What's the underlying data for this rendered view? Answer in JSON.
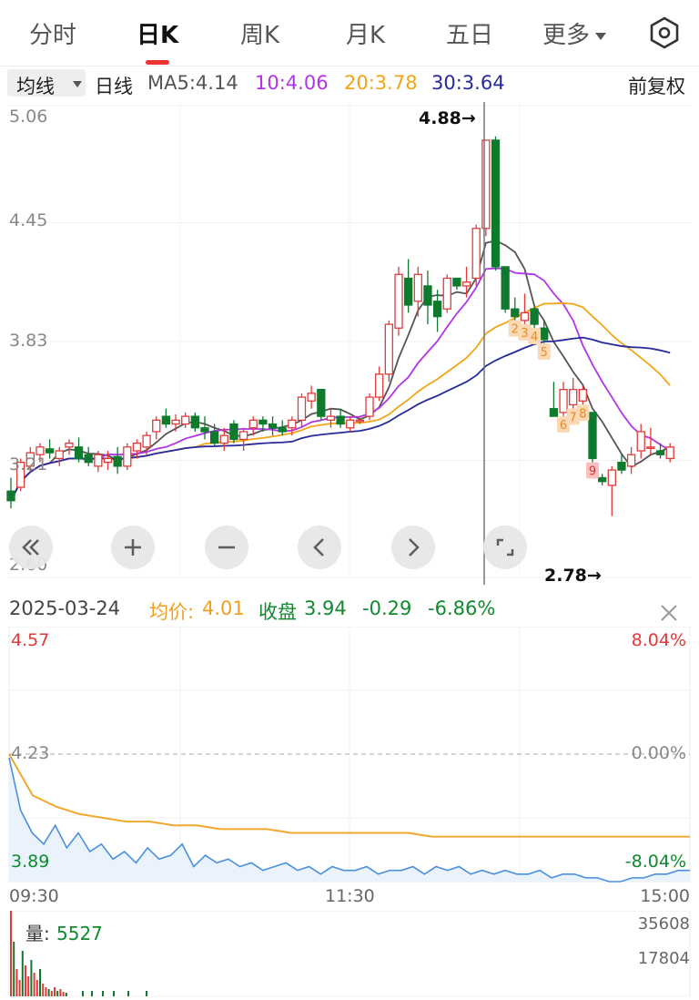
{
  "tabs": [
    {
      "label": "分时"
    },
    {
      "label": "日K"
    },
    {
      "label": "周K"
    },
    {
      "label": "月K"
    },
    {
      "label": "五日"
    },
    {
      "label": "更多"
    }
  ],
  "active_tab": "日K",
  "ma_bar": {
    "dropdown": "均线",
    "period": "日线",
    "ma5": "MA5:4.14",
    "ma10": "10:4.06",
    "ma20": "20:3.78",
    "ma30": "30:3.64",
    "adjust": "前复权"
  },
  "colors": {
    "up": "#e23a3a",
    "down": "#0f7a2e",
    "ma5": "#555555",
    "ma10": "#b233e8",
    "ma20": "#f2a516",
    "ma30": "#262a9a",
    "avg_price": "#f0a830",
    "price_line": "#4a8fdc"
  },
  "kline": {
    "y_labels": [
      "5.06",
      "4.45",
      "3.83",
      "3.21",
      "2.60"
    ],
    "high_marker": "4.88→",
    "low_marker": "2.78→",
    "seq_labels": [
      "2",
      "3",
      "4",
      "5",
      "6",
      "7",
      "8",
      "9"
    ],
    "controls": [
      "rewind-icon",
      "zoom-in-icon",
      "zoom-out-icon",
      "prev-icon",
      "next-icon",
      "fullscreen-icon"
    ],
    "candles": [
      [
        3.05,
        3.12,
        2.96,
        3.0
      ],
      [
        3.07,
        3.22,
        3.05,
        3.2
      ],
      [
        3.18,
        3.28,
        3.15,
        3.25
      ],
      [
        3.24,
        3.3,
        3.2,
        3.28
      ],
      [
        3.27,
        3.32,
        3.22,
        3.25
      ],
      [
        3.22,
        3.28,
        3.18,
        3.26
      ],
      [
        3.28,
        3.32,
        3.24,
        3.3
      ],
      [
        3.28,
        3.33,
        3.2,
        3.22
      ],
      [
        3.24,
        3.28,
        3.18,
        3.2
      ],
      [
        3.18,
        3.26,
        3.15,
        3.24
      ],
      [
        3.2,
        3.26,
        3.16,
        3.22
      ],
      [
        3.23,
        3.28,
        3.14,
        3.18
      ],
      [
        3.18,
        3.3,
        3.16,
        3.28
      ],
      [
        3.26,
        3.32,
        3.22,
        3.3
      ],
      [
        3.28,
        3.36,
        3.24,
        3.34
      ],
      [
        3.36,
        3.44,
        3.32,
        3.42
      ],
      [
        3.44,
        3.48,
        3.38,
        3.4
      ],
      [
        3.4,
        3.45,
        3.36,
        3.42
      ],
      [
        3.4,
        3.46,
        3.38,
        3.44
      ],
      [
        3.44,
        3.46,
        3.36,
        3.38
      ],
      [
        3.38,
        3.44,
        3.32,
        3.36
      ],
      [
        3.36,
        3.4,
        3.28,
        3.3
      ],
      [
        3.3,
        3.38,
        3.26,
        3.34
      ],
      [
        3.4,
        3.42,
        3.3,
        3.32
      ],
      [
        3.32,
        3.38,
        3.26,
        3.36
      ],
      [
        3.38,
        3.44,
        3.34,
        3.42
      ],
      [
        3.42,
        3.44,
        3.36,
        3.4
      ],
      [
        3.4,
        3.44,
        3.34,
        3.38
      ],
      [
        3.38,
        3.42,
        3.34,
        3.36
      ],
      [
        3.38,
        3.44,
        3.34,
        3.42
      ],
      [
        3.42,
        3.56,
        3.38,
        3.54
      ],
      [
        3.52,
        3.6,
        3.48,
        3.56
      ],
      [
        3.58,
        3.56,
        3.42,
        3.44
      ],
      [
        3.42,
        3.48,
        3.38,
        3.44
      ],
      [
        3.44,
        3.48,
        3.38,
        3.4
      ],
      [
        3.38,
        3.44,
        3.36,
        3.42
      ],
      [
        3.42,
        3.44,
        3.4,
        3.42
      ],
      [
        3.44,
        3.56,
        3.42,
        3.54
      ],
      [
        3.54,
        3.7,
        3.52,
        3.66
      ],
      [
        3.66,
        3.94,
        3.62,
        3.92
      ],
      [
        3.9,
        4.22,
        3.86,
        4.18
      ],
      [
        4.16,
        4.26,
        3.98,
        4.02
      ],
      [
        4.04,
        4.22,
        3.96,
        4.18
      ],
      [
        4.12,
        4.2,
        3.92,
        4.02
      ],
      [
        4.04,
        4.1,
        3.88,
        3.96
      ],
      [
        4.0,
        4.18,
        3.98,
        4.16
      ],
      [
        4.16,
        4.14,
        4.1,
        4.12
      ],
      [
        4.12,
        4.22,
        4.06,
        4.14
      ],
      [
        4.16,
        4.44,
        4.12,
        4.42
      ],
      [
        4.42,
        4.88,
        4.38,
        4.88
      ],
      [
        4.88,
        4.9,
        4.2,
        4.22
      ],
      [
        4.22,
        4.22,
        3.98,
        4.0
      ],
      [
        4.0,
        4.06,
        3.94,
        3.96
      ],
      [
        3.94,
        4.08,
        3.86,
        3.98
      ],
      [
        4.0,
        4.02,
        3.9,
        3.92
      ],
      [
        3.9,
        3.94,
        3.82,
        3.84
      ],
      [
        3.48,
        3.62,
        3.44,
        3.44
      ],
      [
        3.46,
        3.62,
        3.42,
        3.58
      ],
      [
        3.5,
        3.64,
        3.46,
        3.58
      ],
      [
        3.52,
        3.6,
        3.46,
        3.58
      ],
      [
        3.46,
        3.42,
        3.2,
        3.22
      ],
      [
        3.12,
        3.14,
        3.08,
        3.1
      ],
      [
        3.08,
        3.18,
        2.92,
        3.16
      ],
      [
        3.2,
        3.24,
        3.14,
        3.16
      ],
      [
        3.18,
        3.28,
        3.14,
        3.24
      ],
      [
        3.26,
        3.4,
        3.22,
        3.36
      ],
      [
        3.28,
        3.38,
        3.24,
        3.28
      ],
      [
        3.26,
        3.3,
        3.22,
        3.24
      ],
      [
        3.22,
        3.3,
        3.2,
        3.28
      ]
    ]
  },
  "intraday": {
    "date": "2025-03-24",
    "avg_label": "均价:",
    "avg_value": "4.01",
    "close_label": "收盘",
    "close_value": "3.94",
    "change": "-0.29",
    "change_pct": "-6.86%",
    "price_high": "4.57",
    "price_mid": "4.23",
    "price_low": "3.89",
    "pct_high": "8.04%",
    "pct_mid": "0.00%",
    "pct_low": "-8.04%",
    "time_start": "09:30",
    "time_mid": "11:30",
    "time_end": "15:00",
    "price_series": [
      4.22,
      4.08,
      4.02,
      3.99,
      4.04,
      3.98,
      4.02,
      3.97,
      3.99,
      3.95,
      3.97,
      3.94,
      3.98,
      3.95,
      3.96,
      3.99,
      3.93,
      3.96,
      3.94,
      3.95,
      3.93,
      3.94,
      3.92,
      3.93,
      3.94,
      3.92,
      3.93,
      3.91,
      3.93,
      3.92,
      3.92,
      3.93,
      3.91,
      3.92,
      3.92,
      3.93,
      3.91,
      3.93,
      3.92,
      3.93,
      3.91,
      3.92,
      3.91,
      3.92,
      3.91,
      3.91,
      3.92,
      3.9,
      3.91,
      3.91,
      3.9,
      3.9,
      3.89,
      3.89,
      3.9,
      3.9,
      3.91,
      3.91,
      3.92,
      3.92
    ],
    "avg_series": [
      4.23,
      4.12,
      4.09,
      4.07,
      4.06,
      4.05,
      4.05,
      4.04,
      4.04,
      4.03,
      4.03,
      4.03,
      4.02,
      4.02,
      4.02,
      4.02,
      4.02,
      4.02,
      4.01,
      4.01,
      4.01,
      4.01,
      4.01,
      4.01,
      4.01,
      4.01,
      4.01,
      4.01,
      4.01,
      4.01
    ]
  },
  "volume": {
    "label": "量:",
    "value": "5527",
    "top": "35608",
    "mid": "17804"
  }
}
